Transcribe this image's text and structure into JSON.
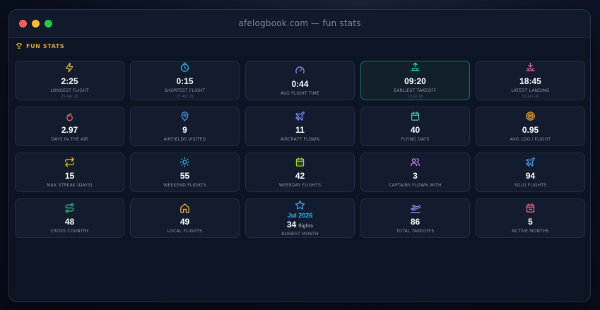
{
  "window": {
    "title": "afelogbook.com — fun stats"
  },
  "section": {
    "title": "FUN STATS",
    "accent": "#e0a52e"
  },
  "stats": {
    "longest_flight": {
      "value": "2:25",
      "label": "LONGEST FLIGHT",
      "sub": "25 Apr 26",
      "icon": "bolt-icon",
      "color": "#f5b82e"
    },
    "shortest_flight": {
      "value": "0:15",
      "label": "SHORTEST FLIGHT",
      "sub": "23 Apr 26",
      "icon": "stopwatch-icon",
      "color": "#2fb8e8"
    },
    "avg_flight_time": {
      "value": "0:44",
      "label": "AVG FLIGHT TIME",
      "icon": "gauge-icon",
      "color": "#9b8cf0"
    },
    "earliest_takeoff": {
      "value": "09:20",
      "label": "EARLIEST TAKEOFF",
      "sub": "15 Jul 26",
      "icon": "sunrise-icon",
      "color": "#2fd0a8"
    },
    "latest_landing": {
      "value": "18:45",
      "label": "LATEST LANDING",
      "sub": "30 Jun 26",
      "icon": "sunset-icon",
      "color": "#e862b0"
    },
    "days_in_air": {
      "value": "2.97",
      "label": "DAYS IN THE AIR",
      "icon": "flame-icon",
      "color": "#f06a6a"
    },
    "airfields_visited": {
      "value": "9",
      "label": "AIRFIELDS VISITED",
      "icon": "map-pin-icon",
      "color": "#4a9cf0"
    },
    "aircraft_flown": {
      "value": "11",
      "label": "AIRCRAFT FLOWN",
      "icon": "plane-icon",
      "color": "#7f8cf5"
    },
    "flying_days": {
      "value": "40",
      "label": "FLYING DAYS",
      "icon": "calendar-icon",
      "color": "#2fd0a8"
    },
    "avg_ldg_flight": {
      "value": "0.95",
      "label": "AVG LDG / FLIGHT",
      "icon": "target-icon",
      "color": "#f5a22e"
    },
    "max_streak": {
      "value": "15",
      "label": "MAX STREAK (DAYS)",
      "icon": "repeat-icon",
      "color": "#f5b82e"
    },
    "weekend_flights": {
      "value": "55",
      "label": "WEEKEND FLIGHTS",
      "icon": "sun-icon",
      "color": "#2fb8e8"
    },
    "weekday_flights": {
      "value": "42",
      "label": "WEEKDAY FLIGHTS",
      "icon": "calendar-days-icon",
      "color": "#a8d832"
    },
    "captains_flown_with": {
      "value": "3",
      "label": "CAPTAINS FLOWN WITH",
      "icon": "users-icon",
      "color": "#c88cf5"
    },
    "solo_flights": {
      "value": "94",
      "label": "SOLO FLIGHTS",
      "icon": "plane-icon",
      "color": "#4a9cf0"
    },
    "cross_country": {
      "value": "48",
      "label": "CROSS COUNTRY",
      "icon": "route-icon",
      "color": "#2fd08a"
    },
    "local_flights": {
      "value": "49",
      "label": "LOCAL FLIGHTS",
      "icon": "home-icon",
      "color": "#f5b82e"
    },
    "busiest_month": {
      "month": "Jul 2026",
      "value": "34",
      "unit": "flights",
      "label": "BUSIEST MONTH",
      "icon": "star-icon",
      "color": "#2fb8e8"
    },
    "total_takeoffs": {
      "value": "86",
      "label": "TOTAL TAKEOFFS",
      "icon": "plane-takeoff-icon",
      "color": "#9b8cf0"
    },
    "active_months": {
      "value": "5",
      "label": "ACTIVE MONTHS",
      "icon": "calendar-icon",
      "color": "#f06a8a"
    }
  }
}
